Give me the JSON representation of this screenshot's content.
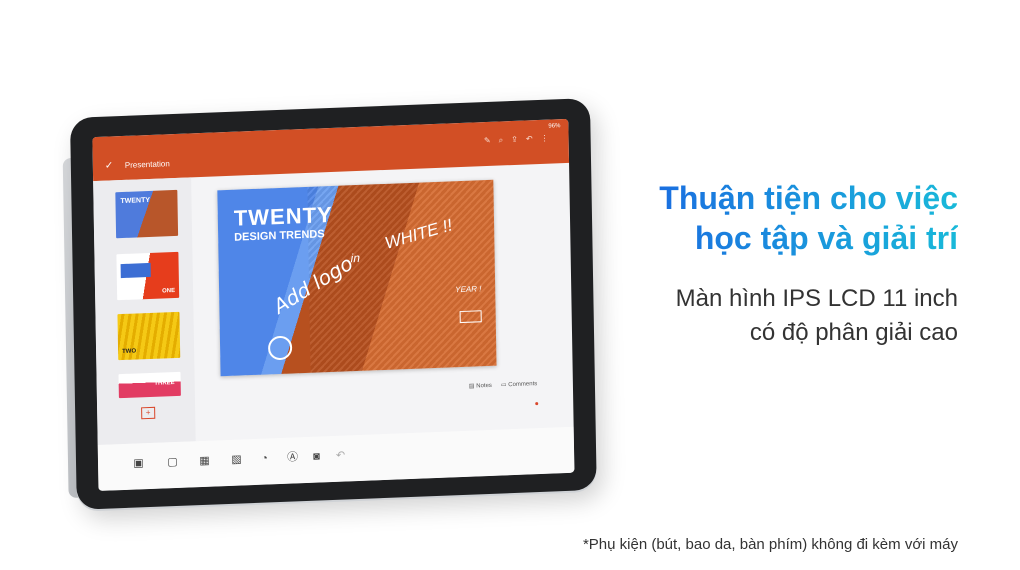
{
  "headline": {
    "line1": "Thuận tiện cho việc",
    "line2": "học tập và giải trí"
  },
  "subhead": {
    "line1": "Màn hình IPS LCD 11 inch",
    "line2": "có độ phân giải cao"
  },
  "footnote": "*Phụ kiện (bút, bao da, bàn phím) không đi kèm với máy",
  "tablet": {
    "app_title": "Presentation",
    "status_battery": "96%",
    "slide": {
      "heading": "TWENTY",
      "subheading": "DESIGN TRENDS",
      "handwriting_add_logo": "Add logo",
      "handwriting_in": "in",
      "handwriting_white": "WHITE !!",
      "handwriting_year": "YEAR !"
    },
    "thumbnails": [
      {
        "label": "TWENTY"
      },
      {
        "label": "ONE"
      },
      {
        "label": "TWO"
      },
      {
        "label": "THREE"
      }
    ],
    "notes_label": "Notes",
    "comments_label": "Comments",
    "colors": {
      "accent": "#d24f25",
      "headline_gradient_start": "#1a6fe0",
      "headline_gradient_end": "#19b9d9"
    }
  }
}
